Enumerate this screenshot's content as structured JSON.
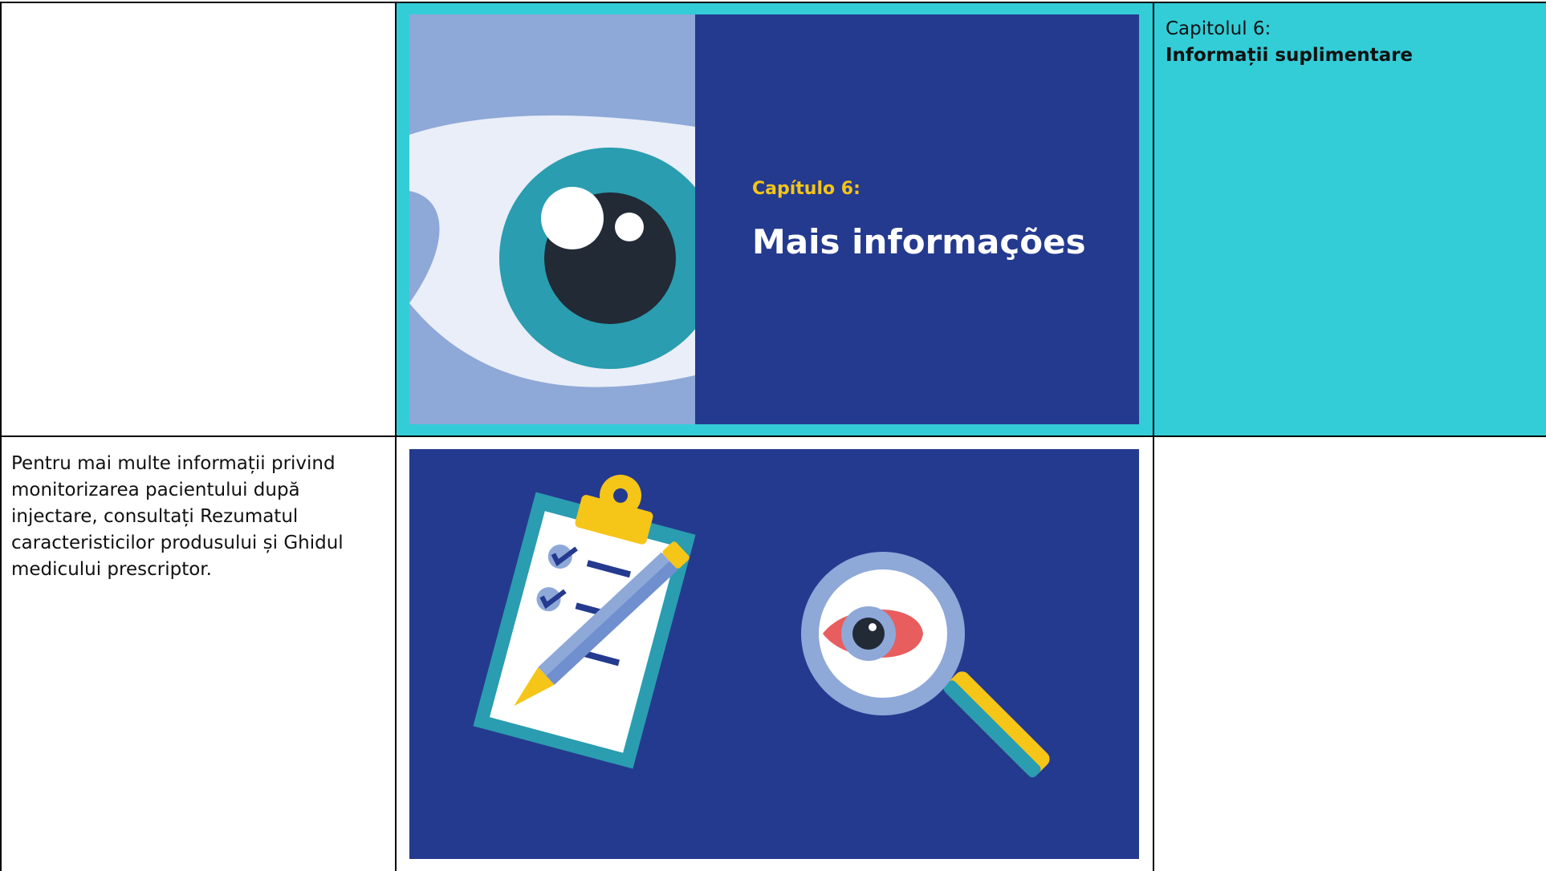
{
  "table": {
    "row1": {
      "slide": {
        "chapter_label": "Capítulo 6:",
        "chapter_title": "Mais informações"
      },
      "right": {
        "chapter_label": "Capitolul 6:",
        "chapter_title": "Informații suplimentare"
      }
    },
    "row2": {
      "left_text": "Pentru mai multe informații privind monitorizarea pacientului după injectare, consultați Rezumatul caracteristicilor produsului și Ghidul medicului prescriptor."
    }
  },
  "colors": {
    "teal_cell": "#33cdd8",
    "slide_navy": "#243a8f",
    "slide_light_blue": "#8ea8d8",
    "accent_yellow": "#f5c518",
    "iris_teal": "#2a9db0",
    "pupil_dark": "#212a35",
    "eye_red": "#e85d5d"
  },
  "icons": [
    "eye-icon",
    "clipboard-icon",
    "pencil-icon",
    "magnifier-icon",
    "red-eye-icon",
    "checkmark-icon"
  ]
}
